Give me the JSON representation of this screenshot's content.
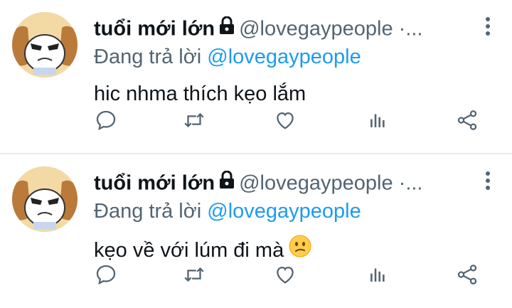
{
  "tweets": [
    {
      "display_name": "tuổi mới lớn",
      "handle": "@lovegaypeople",
      "dots": "·...",
      "reply_prefix": "Đang trả lời",
      "reply_to": "@lovegaypeople",
      "text": "hic nhma thích kẹo lắm",
      "has_emoji": false
    },
    {
      "display_name": "tuổi mới lớn",
      "handle": "@lovegaypeople",
      "dots": "·...",
      "reply_prefix": "Đang trả lời",
      "reply_to": "@lovegaypeople",
      "text": "kẹo về với lúm đi mà",
      "has_emoji": true,
      "emoji_name": "confused-face"
    }
  ],
  "colors": {
    "text": "#0f1419",
    "secondary": "#536471",
    "mention": "#1d9bf0",
    "divider": "#e6ecf0"
  },
  "icons": [
    "reply-icon",
    "retweet-icon",
    "like-icon",
    "analytics-icon",
    "share-icon",
    "more-options-icon",
    "lock-icon"
  ]
}
